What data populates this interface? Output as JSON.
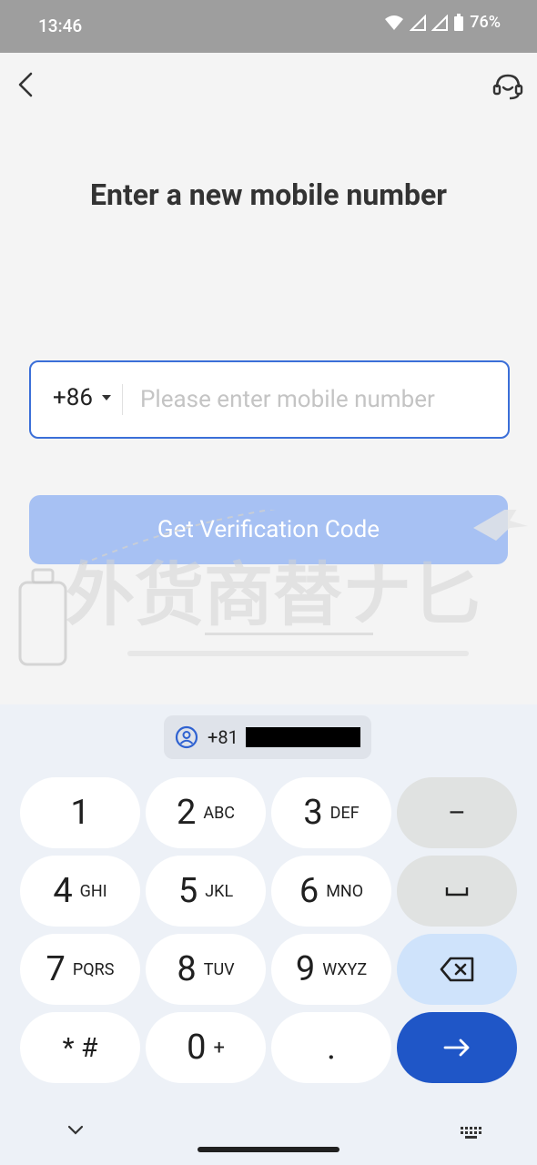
{
  "status_bar": {
    "time": "13:46",
    "battery": "76%"
  },
  "header": {
    "title": "Enter a new mobile number"
  },
  "phone": {
    "country_code": "+86",
    "placeholder": "Please enter mobile number"
  },
  "verify_button": {
    "label": "Get Verification Code"
  },
  "watermark": {
    "text": "外货商替ナ匕"
  },
  "keyboard": {
    "suggestion": {
      "prefix": "+81"
    },
    "keys": [
      {
        "d": "1",
        "l": ""
      },
      {
        "d": "2",
        "l": "ABC"
      },
      {
        "d": "3",
        "l": "DEF"
      },
      {
        "d": "–",
        "l": ""
      },
      {
        "d": "4",
        "l": "GHI"
      },
      {
        "d": "5",
        "l": "JKL"
      },
      {
        "d": "6",
        "l": "MNO"
      },
      {
        "d": "␣",
        "l": ""
      },
      {
        "d": "7",
        "l": "PQRS"
      },
      {
        "d": "8",
        "l": "TUV"
      },
      {
        "d": "9",
        "l": "WXYZ"
      },
      {
        "d": "⌫",
        "l": ""
      },
      {
        "d": "* #",
        "l": ""
      },
      {
        "d": "0",
        "l": "+"
      },
      {
        "d": ".",
        "l": ""
      },
      {
        "d": "→",
        "l": ""
      }
    ]
  }
}
